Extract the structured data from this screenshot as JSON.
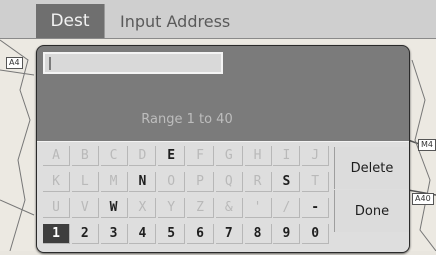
{
  "tabs": {
    "dest": "Dest",
    "input_address": "Input Address"
  },
  "map": {
    "labels": {
      "a4": "A4",
      "m4": "M4",
      "a40": "A40"
    }
  },
  "dialog": {
    "input_value": "",
    "range_text": "Range 1 to 40",
    "keys": [
      [
        "A",
        "B",
        "C",
        "D",
        "E",
        "F",
        "G",
        "H",
        "I",
        "J"
      ],
      [
        "K",
        "L",
        "M",
        "N",
        "O",
        "P",
        "Q",
        "R",
        "S",
        "T"
      ],
      [
        "U",
        "V",
        "W",
        "X",
        "Y",
        "Z",
        "&",
        "'",
        "/",
        "-"
      ],
      [
        "1",
        "2",
        "3",
        "4",
        "5",
        "6",
        "7",
        "8",
        "9",
        "0"
      ]
    ],
    "active_keys": [
      "E",
      "N",
      "W",
      "S",
      "-",
      "1",
      "2",
      "3",
      "4",
      "5",
      "6",
      "7",
      "8",
      "9",
      "0"
    ],
    "selected_key": "1",
    "delete_label": "Delete",
    "done_label": "Done"
  },
  "colors": {
    "dialog_bg": "#7b7b7b",
    "keyboard_bg": "#dedede",
    "tab_active": "#6f6f6f"
  }
}
